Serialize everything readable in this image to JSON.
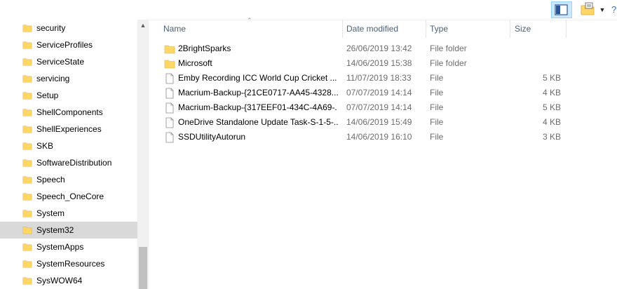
{
  "nav": {
    "items": [
      {
        "label": "security"
      },
      {
        "label": "ServiceProfiles"
      },
      {
        "label": "ServiceState"
      },
      {
        "label": "servicing"
      },
      {
        "label": "Setup"
      },
      {
        "label": "ShellComponents"
      },
      {
        "label": "ShellExperiences"
      },
      {
        "label": "SKB"
      },
      {
        "label": "SoftwareDistribution"
      },
      {
        "label": "Speech"
      },
      {
        "label": "Speech_OneCore"
      },
      {
        "label": "System"
      },
      {
        "label": "System32",
        "selected": true
      },
      {
        "label": "SystemApps"
      },
      {
        "label": "SystemResources"
      },
      {
        "label": "SysWOW64"
      }
    ]
  },
  "columns": {
    "name": "Name",
    "date": "Date modified",
    "type": "Type",
    "size": "Size"
  },
  "files": [
    {
      "name": "2BrightSparks",
      "date": "26/06/2019 13:42",
      "type": "File folder",
      "size": "",
      "icon": "folder-icon"
    },
    {
      "name": "Microsoft",
      "date": "14/06/2019 15:38",
      "type": "File folder",
      "size": "",
      "icon": "folder-icon"
    },
    {
      "name": "Emby Recording ICC World Cup Cricket ...",
      "date": "11/07/2019 18:33",
      "type": "File",
      "size": "5 KB",
      "icon": "file-icon"
    },
    {
      "name": "Macrium-Backup-{21CE0717-AA45-4328...",
      "date": "07/07/2019 14:14",
      "type": "File",
      "size": "4 KB",
      "icon": "file-icon"
    },
    {
      "name": "Macrium-Backup-{317EEF01-434C-4A69-...",
      "date": "07/07/2019 14:14",
      "type": "File",
      "size": "5 KB",
      "icon": "file-icon"
    },
    {
      "name": "OneDrive Standalone Update Task-S-1-5-...",
      "date": "14/06/2019 15:49",
      "type": "File",
      "size": "4 KB",
      "icon": "file-icon"
    },
    {
      "name": "SSDUtilityAutorun",
      "date": "14/06/2019 16:10",
      "type": "File",
      "size": "3 KB",
      "icon": "file-icon"
    }
  ],
  "colors": {
    "folder": "#ffd766",
    "selected_bg": "#d9d9d9",
    "header_text": "#4c607a",
    "secondary_text": "#6d6d6d"
  }
}
